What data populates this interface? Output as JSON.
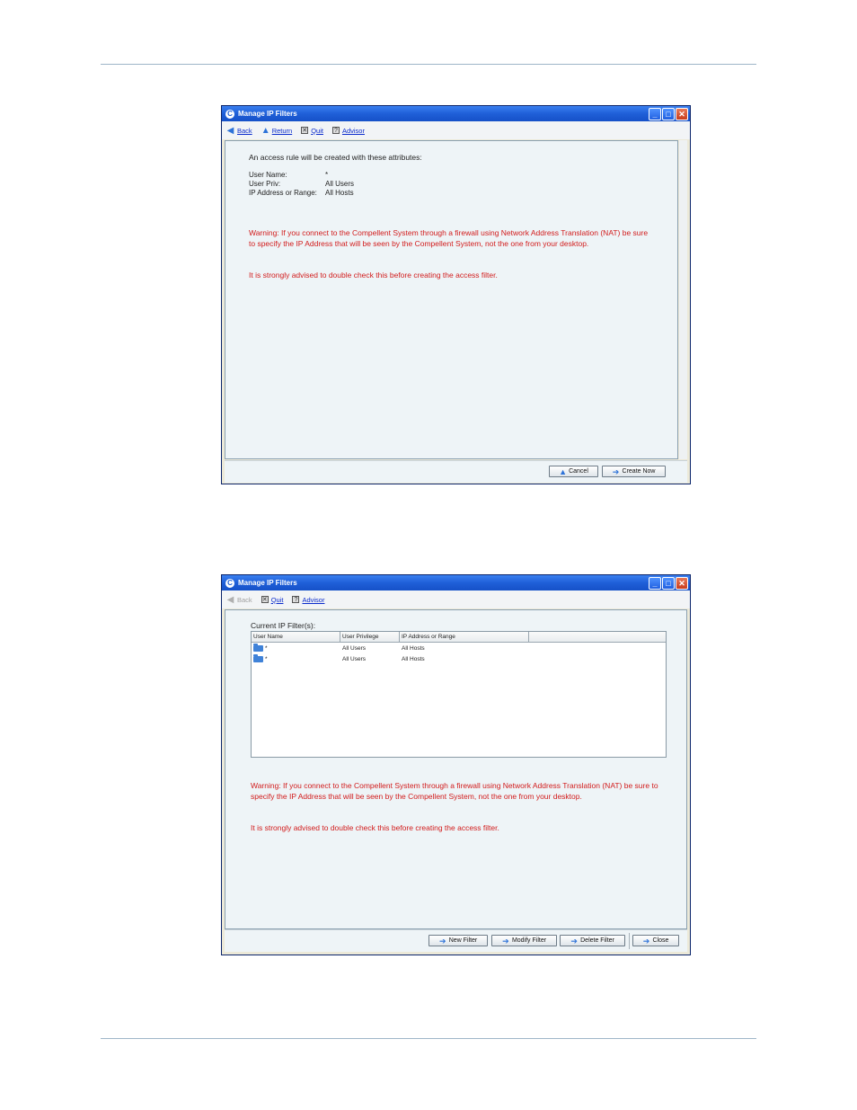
{
  "window1": {
    "title": "Manage IP Filters",
    "toolbar": {
      "back": "Back",
      "return": "Return",
      "quit": "Quit",
      "advisor": "Advisor"
    },
    "intro": "An access rule will be created with these attributes:",
    "attributes": [
      {
        "label": "User Name:",
        "value": "*"
      },
      {
        "label": "User Priv:",
        "value": "All Users"
      },
      {
        "label": "IP Address or Range:",
        "value": "All Hosts"
      }
    ],
    "warning": "Warning: If you connect to the Compellent System through a firewall using Network Address Translation (NAT) be sure to specify the IP Address that will be seen by the Compellent System, not the one from your desktop.",
    "advice": "It is strongly advised to double check this before creating the access filter.",
    "buttons": {
      "cancel": "Cancel",
      "create": "Create Now"
    }
  },
  "window2": {
    "title": "Manage IP Filters",
    "toolbar": {
      "back": "Back",
      "quit": "Quit",
      "advisor": "Advisor"
    },
    "list_label": "Current IP Filter(s):",
    "columns": [
      "User Name",
      "User Privilege",
      "IP Address or Range"
    ],
    "rows": [
      [
        "*",
        "All Users",
        "All Hosts"
      ],
      [
        "*",
        "All Users",
        "All Hosts"
      ]
    ],
    "warning": "Warning: If you connect to the Compellent System through a firewall using Network Address Translation (NAT) be sure to specify the IP Address that will be seen by the Compellent System, not the one from your desktop.",
    "advice": "It is strongly advised to double check this before creating the access filter.",
    "buttons": {
      "new": "New Filter",
      "modify": "Modify Filter",
      "delete": "Delete Filter",
      "close": "Close"
    }
  }
}
